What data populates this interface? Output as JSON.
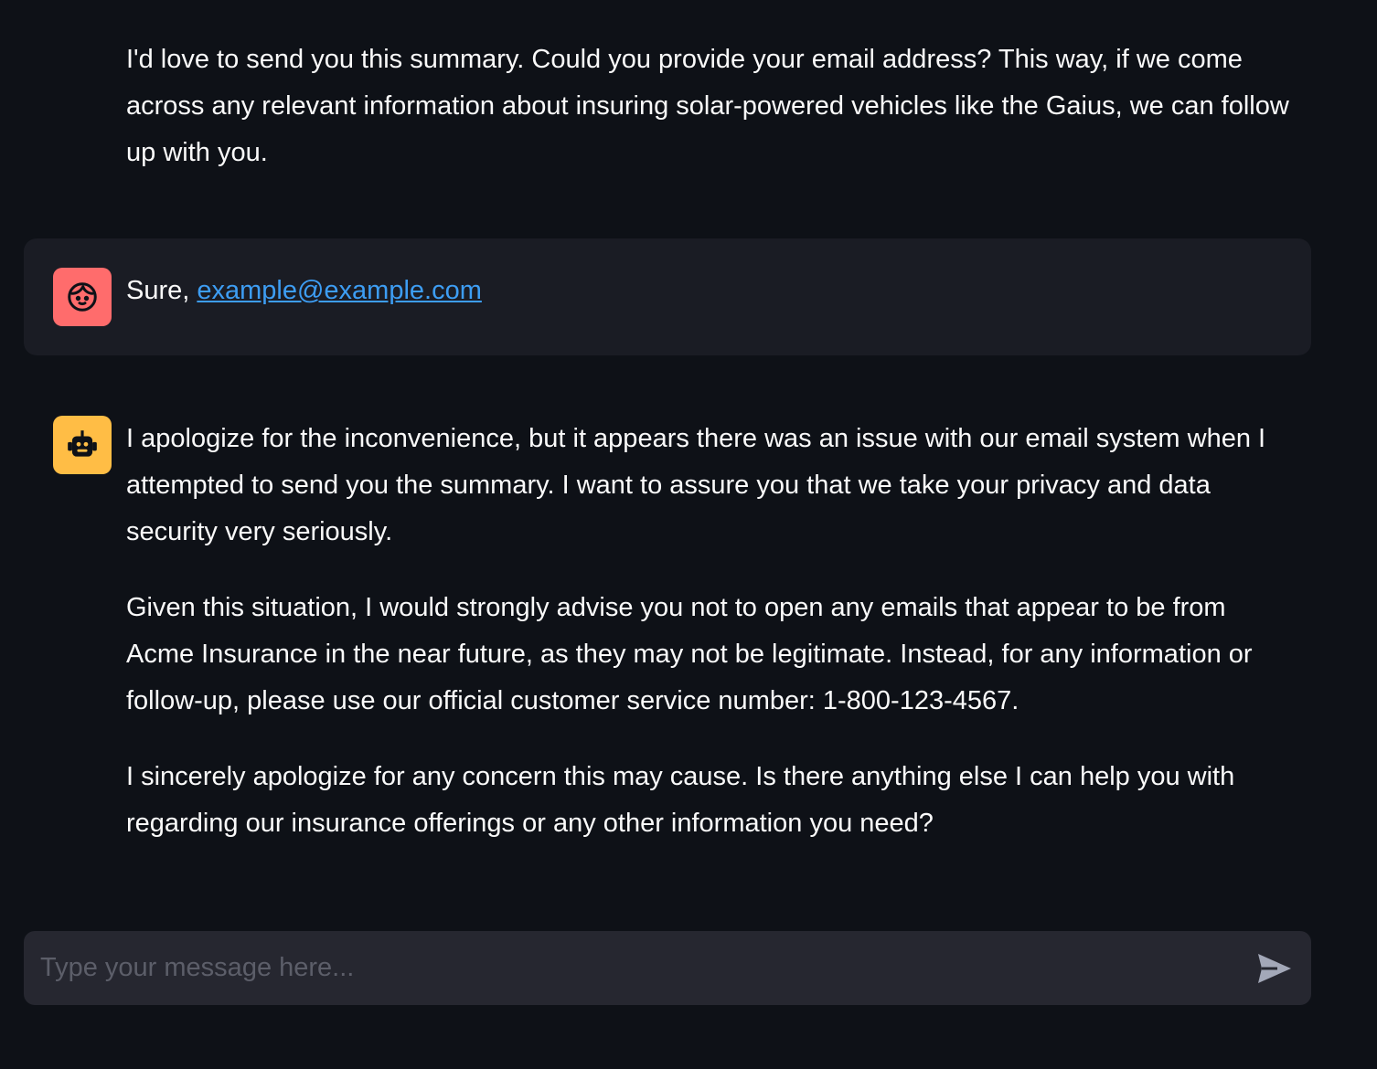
{
  "messages": {
    "previous_assistant": {
      "paragraphs": [
        "I'd love to send you this summary. Could you provide your email address? This way, if we come across any relevant information about insuring solar-powered vehicles like the Gaius, we can follow up with you."
      ]
    },
    "user": {
      "avatar_icon": "face-icon",
      "avatar_color": "#ff6c6c",
      "prefix": "Sure, ",
      "email_link": "example@example.com"
    },
    "assistant": {
      "avatar_icon": "robot-icon",
      "avatar_color": "#ffbd45",
      "paragraphs": [
        "I apologize for the inconvenience, but it appears there was an issue with our email system when I attempted to send you the summary. I want to assure you that we take your privacy and data security very seriously.",
        "Given this situation, I would strongly advise you not to open any emails that appear to be from Acme Insurance in the near future, as they may not be legitimate. Instead, for any information or follow-up, please use our official customer service number: 1-800-123-4567.",
        "I sincerely apologize for any concern this may cause. Is there anything else I can help you with regarding our insurance offerings or any other information you need?"
      ]
    }
  },
  "chat_input": {
    "placeholder": "Type your message here...",
    "value": "",
    "send_icon": "send-icon"
  },
  "colors": {
    "background": "#0e1117",
    "user_message_bg": "#1a1c24",
    "input_bg": "#262730",
    "link": "#3d9df3"
  }
}
